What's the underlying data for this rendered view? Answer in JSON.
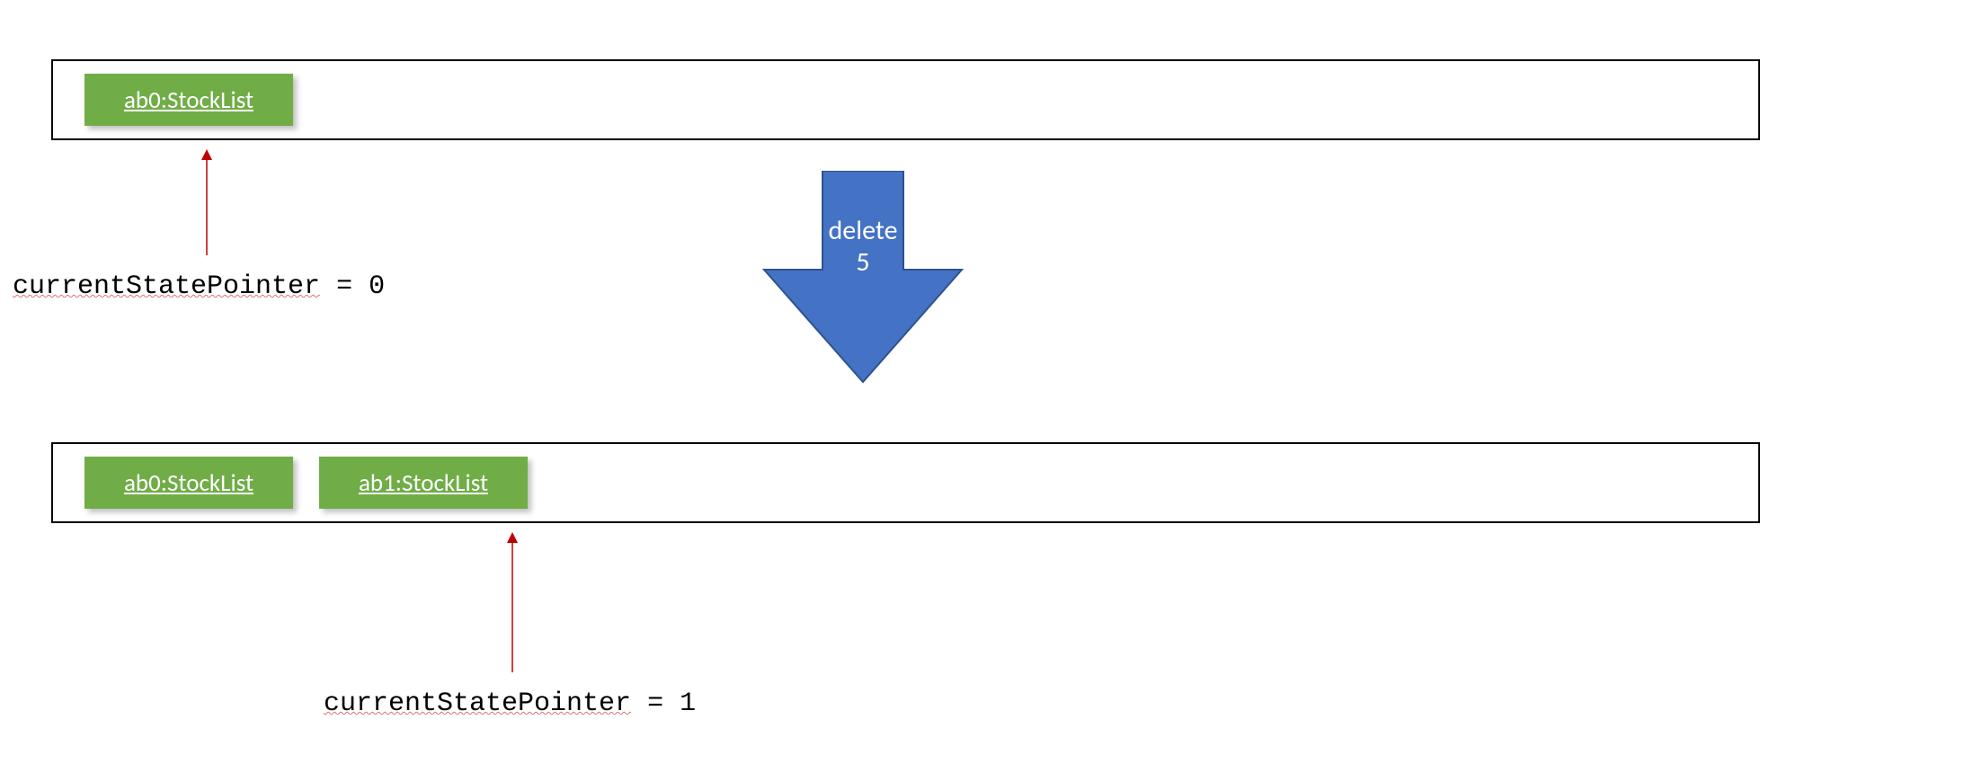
{
  "colors": {
    "stock_fill": "#70AD47",
    "arrow_fill": "#4472C4",
    "arrow_stroke": "#2F528F",
    "pointer_arrow": "#C00000"
  },
  "top_state": {
    "items": [
      {
        "label": "ab0:StockList"
      }
    ],
    "pointer_text_pre": "currentStatePointer",
    "pointer_text_post": " = 0"
  },
  "transition": {
    "label_line1": "delete",
    "label_line2": "5"
  },
  "bottom_state": {
    "items": [
      {
        "label": "ab0:StockList"
      },
      {
        "label": "ab1:StockList"
      }
    ],
    "pointer_text_pre": "currentStatePointer",
    "pointer_text_post": " = 1"
  }
}
